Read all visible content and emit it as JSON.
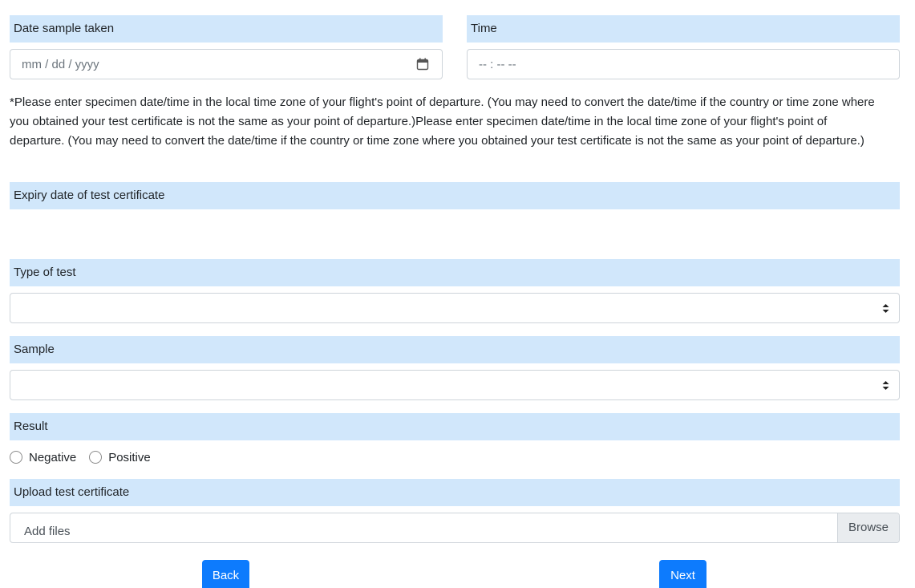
{
  "date_section": {
    "label": "Date sample taken",
    "placeholder": "mm / dd / yyyy",
    "icon": "calendar-icon"
  },
  "time_section": {
    "label": "Time",
    "placeholder": "-- : --   --"
  },
  "note": "*Please enter specimen date/time in the local time zone of your flight's point of departure. (You may need to convert the date/time if the country or time zone where you obtained your test certificate is not the same as your point of departure.)Please enter specimen date/time in the local time zone of your flight's point of departure. (You may need to convert the date/time if the country or time zone where you obtained your test certificate is not the same as your point of departure.)",
  "expiry": {
    "label": "Expiry date of test certificate"
  },
  "type_of_test": {
    "label": "Type of test",
    "selected": ""
  },
  "sample": {
    "label": "Sample",
    "selected": ""
  },
  "result": {
    "label": "Result",
    "options": [
      "Negative",
      "Positive"
    ]
  },
  "upload": {
    "label": "Upload test certificate",
    "placeholder": "Add files",
    "browse": "Browse"
  },
  "buttons": {
    "back": "Back",
    "next": "Next"
  },
  "colors": {
    "label_bg": "#d1e7fb",
    "primary": "#0d7bfd",
    "border": "#ced4da"
  }
}
